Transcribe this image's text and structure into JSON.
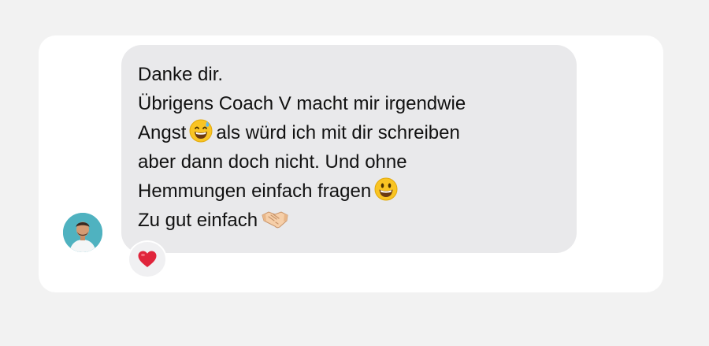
{
  "chat": {
    "contact_avatar_icon": "person-avatar-icon",
    "message": {
      "line1": "Danke dir.",
      "line2": "Übrigens Coach V macht mir irgendwie",
      "line3_before_emoji": "Angst",
      "line3_emoji_icon": "grinning-sweat-emoji-icon",
      "line3_after_emoji": "als würd ich mit dir schreiben",
      "line4": "aber dann doch nicht. Und ohne",
      "line5_text": "Hemmungen einfach fragen",
      "line5_emoji_icon": "grinning-face-emoji-icon",
      "line6_text": "Zu gut einfach",
      "line6_emoji_icon": "handshake-emoji-icon"
    },
    "reaction": {
      "icon": "red-heart-icon",
      "color": "#e0243b"
    },
    "colors": {
      "page_background": "#f2f2f2",
      "card_background": "#ffffff",
      "bubble_background": "#e9e9eb",
      "text": "#111111",
      "avatar_background": "#4fb2c0"
    }
  }
}
